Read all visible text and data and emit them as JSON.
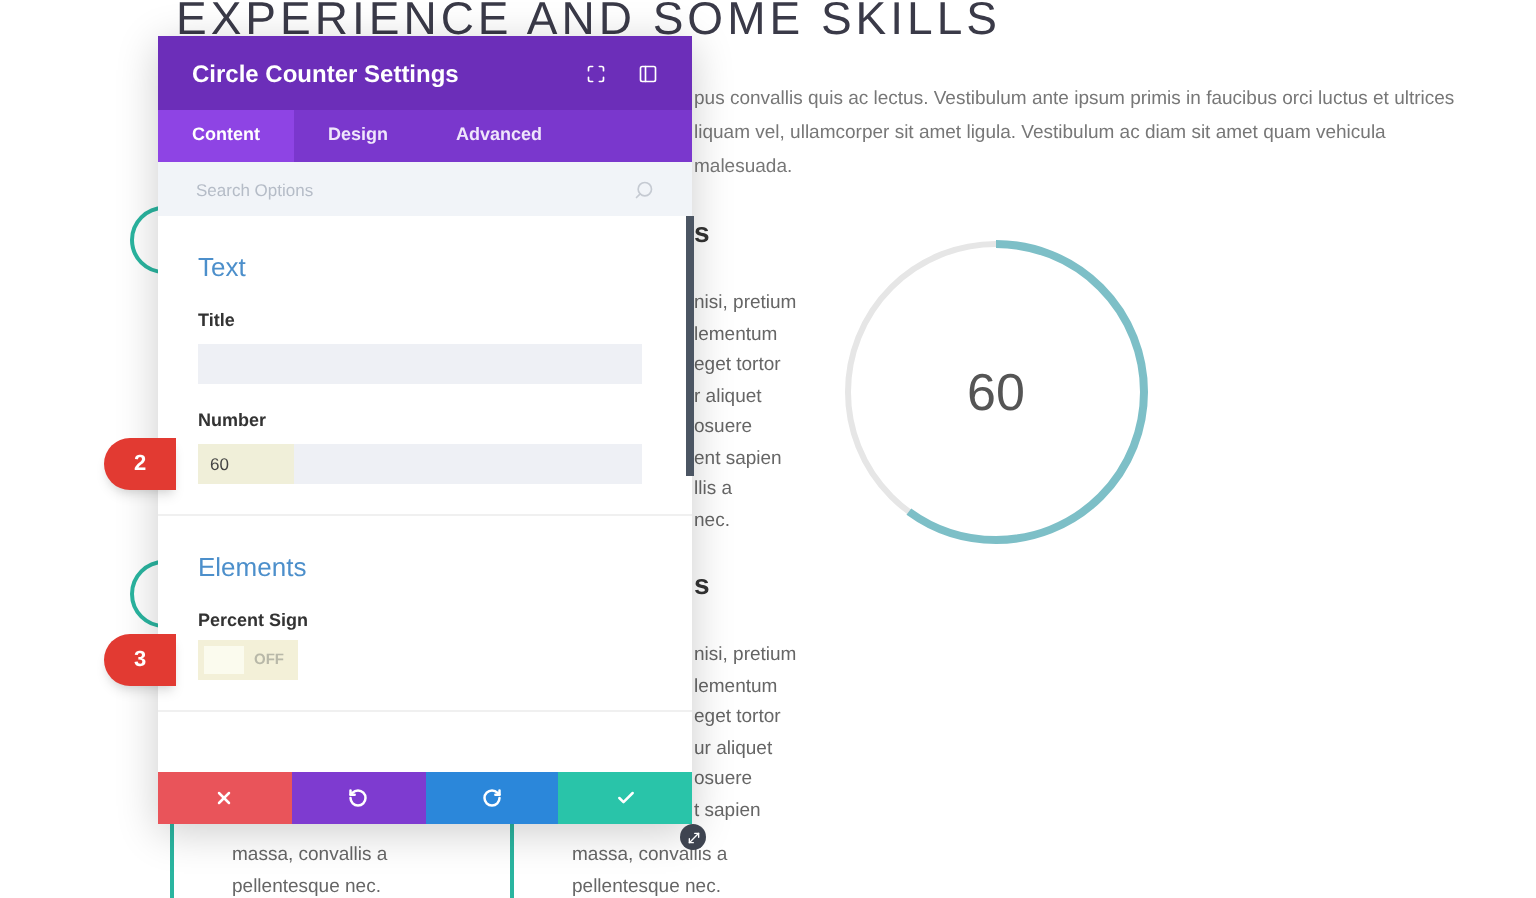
{
  "page": {
    "heading": "EXPERIENCE AND SOME SKILLS",
    "intro_lines": [
      "pus convallis quis ac lectus. Vestibulum ante ipsum primis in faucibus orci luctus et ultrices",
      "liquam vel, ullamcorper sit amet ligula. Vestibulum ac diam sit amet quam vehicula",
      "malesuada."
    ],
    "skill_blocks": [
      {
        "heading": "s",
        "lines": [
          "nisi, pretium",
          "lementum",
          "eget tortor",
          "r aliquet",
          "osuere",
          "ent sapien",
          "llis a",
          "nec."
        ]
      },
      {
        "heading": "s",
        "lines": [
          "nisi, pretium",
          "lementum",
          "eget tortor",
          "ur aliquet",
          "osuere",
          "t sapien"
        ]
      }
    ],
    "bottom_columns": [
      {
        "lines": [
          "massa, convallis a",
          "pellentesque nec."
        ]
      },
      {
        "lines": [
          "massa, convallis a",
          "pellentesque nec."
        ]
      }
    ],
    "counter": {
      "value": "60",
      "level": 0.6
    }
  },
  "modal": {
    "title": "Circle Counter Settings",
    "tabs": [
      {
        "label": "Content",
        "selected": true
      },
      {
        "label": "Design",
        "selected": false
      },
      {
        "label": "Advanced",
        "selected": false
      }
    ],
    "search": {
      "placeholder": "Search Options"
    },
    "sections": [
      {
        "title": "Text",
        "fields": [
          {
            "kind": "text",
            "label": "Title"
          },
          {
            "kind": "text",
            "label": "Number",
            "value": "60",
            "marker": "2"
          }
        ]
      },
      {
        "title": "Elements",
        "fields": [
          {
            "kind": "toggle",
            "label": "Percent Sign",
            "on": false,
            "state_text": "OFF",
            "marker": "3"
          }
        ]
      }
    ],
    "footer_buttons": [
      {
        "kind": "cancel"
      },
      {
        "kind": "undo"
      },
      {
        "kind": "redo"
      },
      {
        "kind": "save"
      }
    ]
  }
}
